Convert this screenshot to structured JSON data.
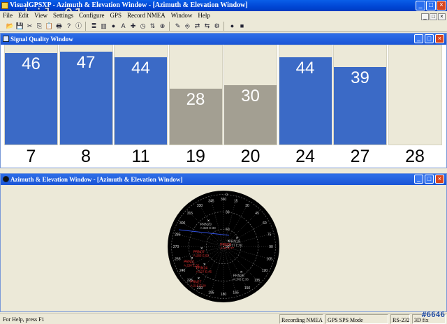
{
  "app": {
    "title": "VisualGPSXP - Azimuth & Elevation Window - [Azimuth & Elevation Window]",
    "window_buttons": {
      "minimize": "_",
      "maximize": "□",
      "close": "×"
    }
  },
  "watermark": {
    "logo": "mobile01",
    "tag": "#6646"
  },
  "menu": [
    "File",
    "Edit",
    "View",
    "Settings",
    "Configure",
    "GPS",
    "Record NMEA",
    "Window",
    "Help"
  ],
  "toolbar": {
    "buttons": [
      {
        "icon": "open-folder-icon",
        "glyph": "📂"
      },
      {
        "icon": "save-icon",
        "glyph": "💾"
      },
      {
        "icon": "cut-icon",
        "glyph": "✂"
      },
      {
        "icon": "copy-icon",
        "glyph": "⎘"
      },
      {
        "icon": "paste-icon",
        "glyph": "📋"
      },
      {
        "icon": "print-icon",
        "glyph": "🖶"
      },
      {
        "icon": "help-icon",
        "glyph": "?"
      },
      {
        "icon": "about-icon",
        "glyph": "ⓘ"
      },
      {
        "icon": "nmea-list-icon",
        "glyph": "≣"
      },
      {
        "icon": "signal-bars-icon",
        "glyph": "▥"
      },
      {
        "icon": "azimuth-icon",
        "glyph": "●"
      },
      {
        "icon": "altitude-icon",
        "glyph": "A"
      },
      {
        "icon": "position-icon",
        "glyph": "✚"
      },
      {
        "icon": "clock-icon",
        "glyph": "◷"
      },
      {
        "icon": "sort-icon",
        "glyph": "⇅"
      },
      {
        "icon": "compass-icon",
        "glyph": "⊕"
      },
      {
        "icon": "survey-icon",
        "glyph": "✎"
      },
      {
        "icon": "record-icon",
        "glyph": "⎆"
      },
      {
        "icon": "connect-icon",
        "glyph": "⇄"
      },
      {
        "icon": "disconnect-icon",
        "glyph": "⇆"
      },
      {
        "icon": "settings-icon",
        "glyph": "⚙"
      },
      {
        "icon": "start-icon",
        "glyph": "●"
      },
      {
        "icon": "stop-icon",
        "glyph": "■"
      }
    ]
  },
  "signal_window": {
    "title": "Signal Quality Window",
    "satellites": [
      {
        "prn": "7",
        "snr": 46,
        "active": true
      },
      {
        "prn": "8",
        "snr": 47,
        "active": true
      },
      {
        "prn": "11",
        "snr": 44,
        "active": true
      },
      {
        "prn": "19",
        "snr": 28,
        "active": false
      },
      {
        "prn": "20",
        "snr": 30,
        "active": false
      },
      {
        "prn": "24",
        "snr": 44,
        "active": true
      },
      {
        "prn": "27",
        "snr": 39,
        "active": true
      },
      {
        "prn": "28",
        "snr": 0,
        "active": false
      }
    ],
    "colors": {
      "active": "#3b6ac6",
      "inactive": "#a39f92",
      "slot": "#ece9d8"
    }
  },
  "azimuth_window": {
    "title": "Azimuth & Elevation Window - [Azimuth & Elevation Window]",
    "azimuth_labels": [
      "360",
      "15",
      "30",
      "45",
      "60",
      "75",
      "90",
      "105",
      "120",
      "135",
      "150",
      "165",
      "180",
      "195",
      "210",
      "225",
      "240",
      "255",
      "270",
      "285",
      "300",
      "315",
      "330",
      "345"
    ],
    "elevation_labels": [
      "90",
      "60",
      "30",
      "0"
    ],
    "satellites": [
      {
        "prn": "PRN07",
        "az": 265,
        "el": 52,
        "label_line2": "A:265 E:52",
        "used": true
      },
      {
        "prn": "PRN08",
        "az": 42,
        "el": 77,
        "label_line2": "A:42 E:77",
        "used": true
      },
      {
        "prn": "PRN11",
        "az": 250,
        "el": 32,
        "label_line2": "A:250 E:32",
        "used": true
      },
      {
        "prn": "PRN19",
        "az": 57,
        "el": 62,
        "label_line2": "A:57 E:62",
        "used": false
      },
      {
        "prn": "PRN20",
        "az": 330,
        "el": 38,
        "label_line2": "A:330 E:38",
        "used": false
      },
      {
        "prn": "PRN24",
        "az": 227,
        "el": 45,
        "label_line2": "A:227 E:45",
        "used": true
      },
      {
        "prn": "PRN27",
        "az": 218,
        "el": 20,
        "label_line2": "A:218 E:20",
        "used": true
      },
      {
        "prn": "PRN28",
        "az": 145,
        "el": 36,
        "label_line2": "A:145 E:36",
        "used": false
      }
    ],
    "colors": {
      "used": "#e03030",
      "unused": "#b8b8b8",
      "dish": "#000000",
      "grid": "#808080"
    }
  },
  "statusbar": {
    "help": "For Help, press F1",
    "recording": "Recording NMEA",
    "mode": "GPS SPS Mode",
    "port": "RS-232",
    "fix": "3D fix"
  }
}
